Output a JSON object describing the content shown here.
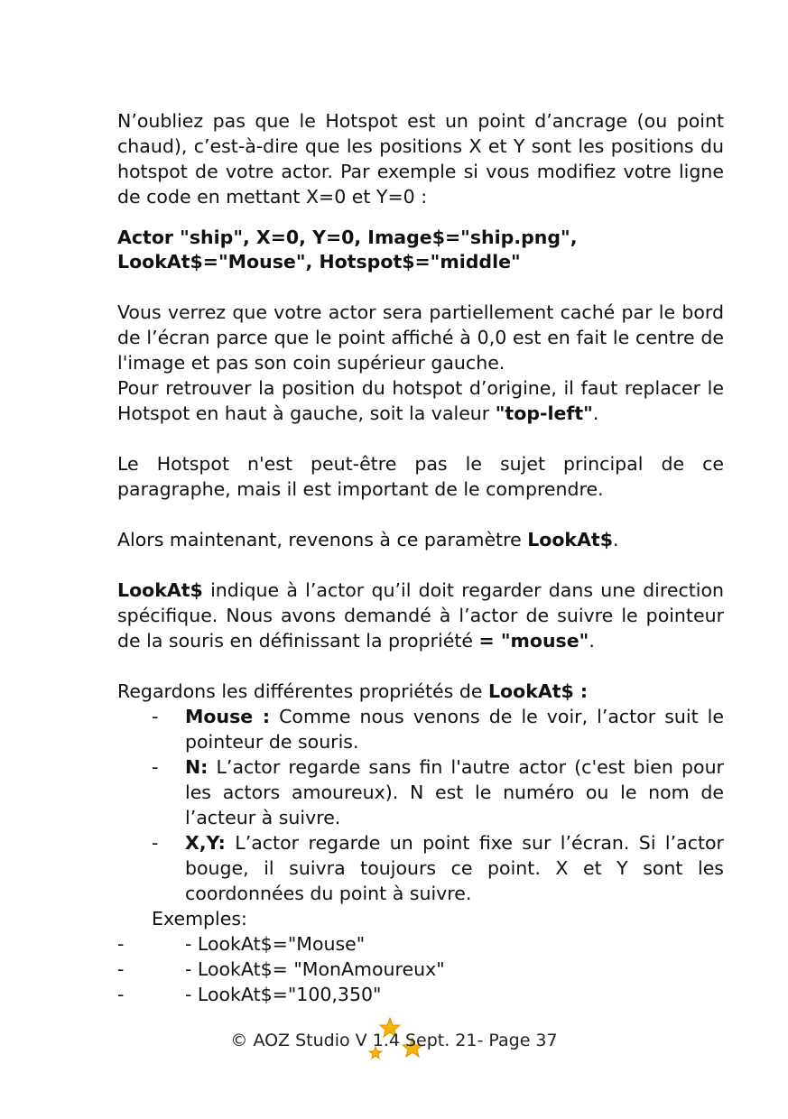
{
  "paragraphs": {
    "p1": "N’oubliez pas que le Hotspot est un point d’ancrage (ou point chaud), c’est-à-dire que les positions X et Y sont les positions du hotspot de votre actor. Par exemple si vous modifiez votre ligne de code en mettant X=0 et Y=0 :",
    "code_line1": "Actor \"ship\", X=0, Y=0, Image$=\"ship.png\",",
    "code_line2": "LookAt$=\"Mouse\", Hotspot$=\"middle\"",
    "p2": "Vous verrez que votre actor sera partiellement caché par le bord de l’écran parce que le point affiché à 0,0 est en  fait le centre de l'image et pas son coin supérieur gauche.",
    "p3_text": "Pour retrouver la position du hotspot d’origine, il faut replacer le Hotspot en haut à gauche, soit la valeur ",
    "p3_bold": "\"top-left\"",
    "p3_end": ".",
    "p4": "Le Hotspot n'est peut-être pas le sujet principal de ce paragraphe, mais il est important de le comprendre.",
    "p5_text": "Alors maintenant, revenons à ce paramètre ",
    "p5_bold": "LookAt$",
    "p5_end": ".",
    "p6_bold": "LookAt$",
    "p6_text": " indique à l’actor qu’il doit regarder dans une direction spécifique. Nous avons demandé à l’actor de suivre le pointeur de la souris en définissant la propriété ",
    "p6_bold2": "= \"mouse\"",
    "p6_end": ".",
    "p7_text": "Regardons les différentes propriétés de ",
    "p7_bold": "LookAt$ :"
  },
  "bullets": [
    {
      "dash": "-",
      "term": "Mouse :",
      "text": " Comme nous venons de le voir, l’actor suit le pointeur de souris."
    },
    {
      "dash": "-",
      "term": "N:",
      "text": " L’actor regarde sans fin l'autre actor (c'est bien pour les actors amoureux). N est le numéro ou le nom de l’acteur à suivre."
    },
    {
      "dash": "-",
      "term": "X,Y:",
      "text": " L’actor regarde un point fixe sur l’écran. Si l’actor bouge, il suivra toujours ce point. X et Y sont les coordonnées du point à suivre."
    }
  ],
  "examples": {
    "label": "Exemples:",
    "items": [
      {
        "dash": "-",
        "text": "- LookAt$=\"Mouse\""
      },
      {
        "dash": "-",
        "text": "- LookAt$= \"MonAmoureux\""
      },
      {
        "dash": "-",
        "text": "- LookAt$=\"100,350\""
      }
    ]
  },
  "footer": {
    "text": "© AOZ Studio V 1.4  Sept. 21- Page 37",
    "star_color": "#F5B400",
    "star_icon": "stars-logo-icon"
  }
}
